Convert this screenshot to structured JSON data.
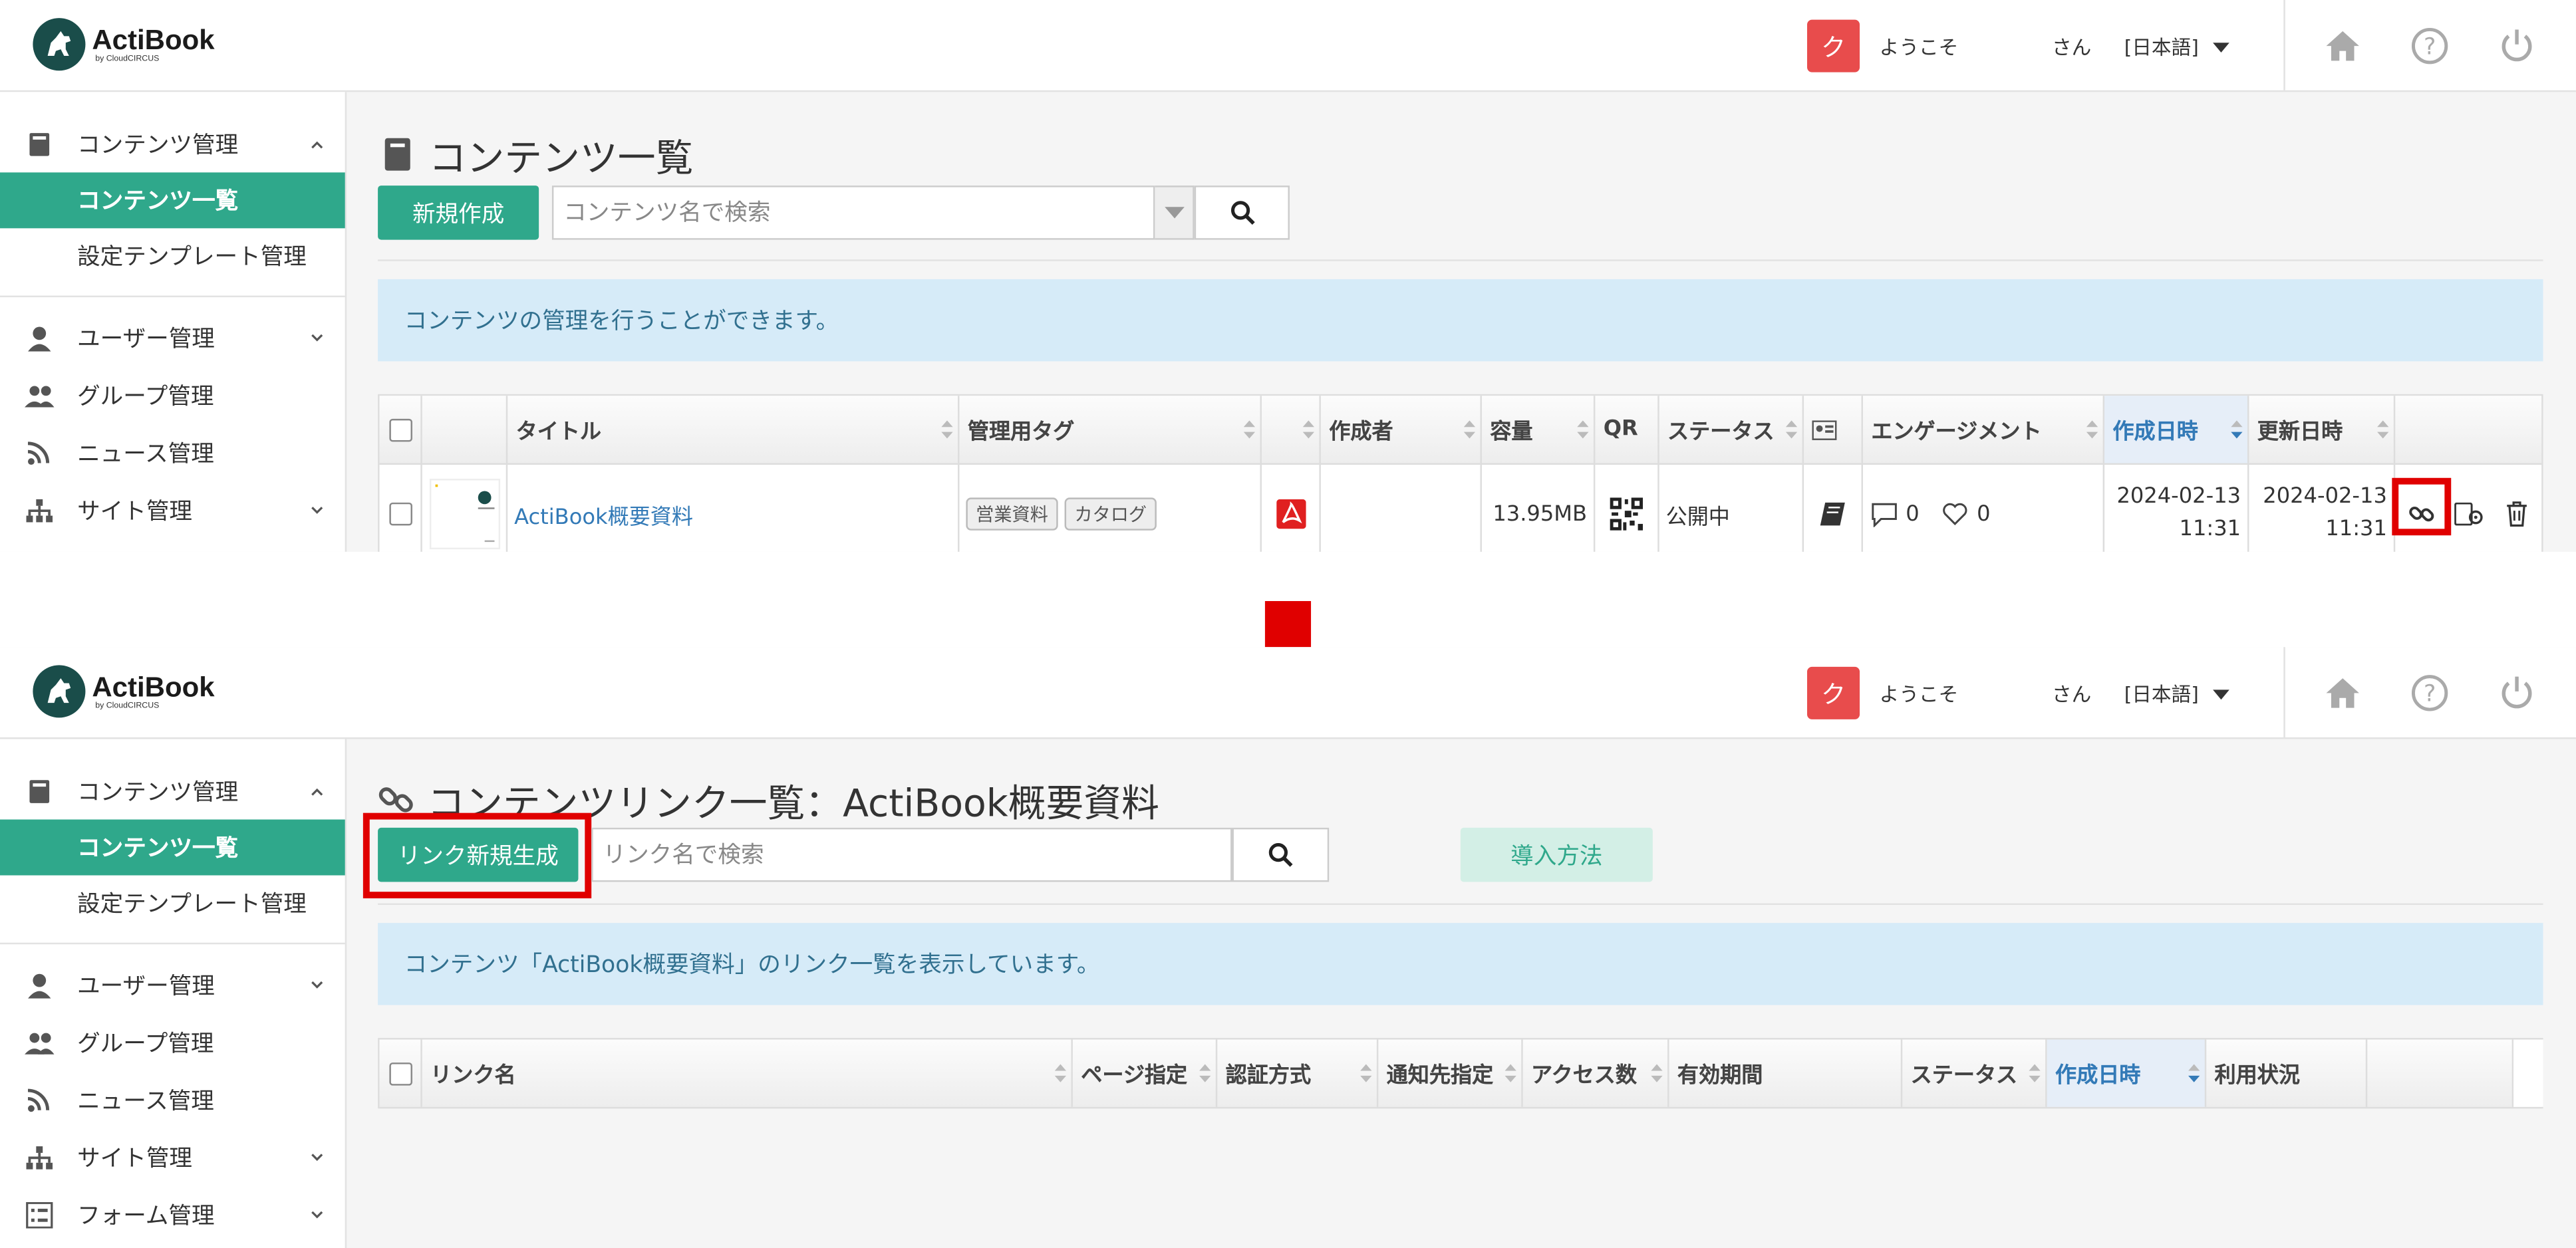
{
  "header": {
    "logo_name": "ActiBook",
    "logo_by": "by CloudCIRCUS",
    "user_initial": "ク",
    "welcome": "ようこそ",
    "san": "さん",
    "language": "[日本語]"
  },
  "sidebar": {
    "content_mgmt": "コンテンツ管理",
    "content_list": "コンテンツ一覧",
    "template_mgmt": "設定テンプレート管理",
    "user_mgmt": "ユーザー管理",
    "group_mgmt": "グループ管理",
    "news_mgmt": "ニュース管理",
    "site_mgmt": "サイト管理",
    "form_mgmt": "フォーム管理"
  },
  "screen1": {
    "title": "コンテンツ一覧",
    "new_button": "新規作成",
    "search_placeholder": "コンテンツ名で検索",
    "info": "コンテンツの管理を行うことができます。",
    "columns": {
      "title": "タイトル",
      "tag": "管理用タグ",
      "author": "作成者",
      "size": "容量",
      "qr": "QR",
      "status": "ステータス",
      "engagement": "エンゲージメント",
      "created": "作成日時",
      "updated": "更新日時"
    },
    "row": {
      "title": "ActiBook概要資料",
      "tags": [
        "営業資料",
        "カタログ"
      ],
      "size": "13.95MB",
      "status": "公開中",
      "comments": "0",
      "likes": "0",
      "created_date": "2024-02-13",
      "created_time": "11:31",
      "updated_date": "2024-02-13",
      "updated_time": "11:31"
    }
  },
  "screen2": {
    "title": "コンテンツリンク一覧：ActiBook概要資料",
    "new_button": "リンク新規生成",
    "search_placeholder": "リンク名で検索",
    "howto_button": "導入方法",
    "info": "コンテンツ「ActiBook概要資料」のリンク一覧を表示しています。",
    "columns": {
      "link_name": "リンク名",
      "page": "ページ指定",
      "auth": "認証方式",
      "notify": "通知先指定",
      "access": "アクセス数",
      "period": "有効期間",
      "status": "ステータス",
      "created": "作成日時",
      "usage": "利用状況"
    }
  },
  "colors": {
    "accent": "#2fa88b",
    "highlight": "#e00000",
    "info_bg": "#d6ebf8",
    "badge": "#e84c4c"
  }
}
